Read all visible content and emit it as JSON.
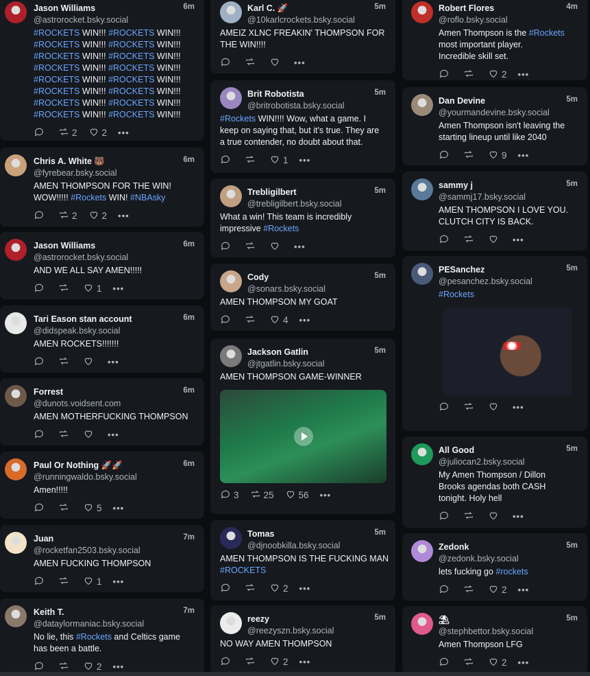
{
  "columns": {
    "a": [
      {
        "name": "Jason Williams",
        "handle": "@astrorocket.bsky.social",
        "time": "6m",
        "text": "#ROCKETS WIN!!! #ROCKETS WIN!!!\n#ROCKETS WIN!!! #ROCKETS WIN!!!\n#ROCKETS WIN!!! #ROCKETS WIN!!!\n#ROCKETS WIN!!! #ROCKETS WIN!!!\n#ROCKETS WIN!!! #ROCKETS WIN!!!\n#ROCKETS WIN!!! #ROCKETS WIN!!!\n#ROCKETS WIN!!! #ROCKETS WIN!!!\n#ROCKETS WIN!!! #ROCKETS WIN!!!",
        "replies": "",
        "reposts": "2",
        "likes": "2",
        "avatar_color": "#b0202a"
      },
      {
        "name": "Chris A. White 🐻",
        "handle": "@fyrebear.bsky.social",
        "time": "6m",
        "text": "AMEN THOMPSON FOR THE WIN!\nWOW!!!!! #Rockets WIN! #NBAsky",
        "replies": "",
        "reposts": "2",
        "likes": "2",
        "avatar_color": "#c9a27a"
      },
      {
        "name": "Jason Williams",
        "handle": "@astrorocket.bsky.social",
        "time": "6m",
        "text": "AND WE ALL SAY AMEN!!!!!",
        "replies": "",
        "reposts": "",
        "likes": "1",
        "avatar_color": "#b0202a"
      },
      {
        "name": "Tari Eason stan account",
        "handle": "@didspeak.bsky.social",
        "time": "6m",
        "text": "AMEN ROCKETS!!!!!!!",
        "replies": "",
        "reposts": "",
        "likes": "",
        "avatar_color": "#e8e8e8"
      },
      {
        "name": "Forrest",
        "handle": "@dunots.voidsent.com",
        "time": "6m",
        "text": "AMEN MOTHERFUCKING THOMPSON",
        "replies": "",
        "reposts": "",
        "likes": "",
        "avatar_color": "#6d5a4a"
      },
      {
        "name": "Paul Or Nothing 🚀🚀",
        "handle": "@runningwaldo.bsky.social",
        "time": "6m",
        "text": "Amen!!!!!",
        "replies": "",
        "reposts": "",
        "likes": "5",
        "avatar_color": "#d86a2a"
      },
      {
        "name": "Juan",
        "handle": "@rocketfan2503.bsky.social",
        "time": "7m",
        "text": "AMEN FUCKING THOMPSON",
        "replies": "",
        "reposts": "",
        "likes": "1",
        "avatar_color": "#f2e3c8"
      },
      {
        "name": "Keith T.",
        "handle": "@dataylormaniac.bsky.social",
        "time": "7m",
        "text": "No lie, this #Rockets and Celtics game\nhas been a battle.",
        "replies": "",
        "reposts": "",
        "likes": "2",
        "avatar_color": "#8a7a6a"
      }
    ],
    "b": [
      {
        "name": "Karl C. 🚀",
        "handle": "@10karlcrockets.bsky.social",
        "time": "5m",
        "text": "AMEIZ XLNC FREAKIN' THOMPSON FOR\nTHE WIN!!!!",
        "replies": "",
        "reposts": "",
        "likes": "",
        "avatar_color": "#9fb0c4"
      },
      {
        "name": "Brit Robotista",
        "handle": "@britrobotista.bsky.social",
        "time": "5m",
        "text": "#Rockets WIN!!!! Wow, what a game. I\nkeep on saying that, but it's true. They are\na true contender, no doubt about that.",
        "replies": "",
        "reposts": "",
        "likes": "1",
        "avatar_color": "#9a86c0"
      },
      {
        "name": "Trebligilbert",
        "handle": "@trebligilbert.bsky.social",
        "time": "5m",
        "text": "What a win! This team is incredibly\nimpressive #Rockets",
        "replies": "",
        "reposts": "",
        "likes": "",
        "avatar_color": "#c0a080"
      },
      {
        "name": "Cody",
        "handle": "@sonars.bsky.social",
        "time": "5m",
        "text": "AMEN THOMPSON MY GOAT",
        "replies": "",
        "reposts": "",
        "likes": "4",
        "avatar_color": "#c8a68a"
      },
      {
        "name": "Jackson Gatlin",
        "handle": "@jtgatlin.bsky.social",
        "time": "5m",
        "text": "AMEN THOMPSON GAME-WINNER",
        "replies": "3",
        "reposts": "25",
        "likes": "56",
        "avatar_color": "#7a7a7a",
        "has_video": true
      },
      {
        "name": "Tomas",
        "handle": "@djnoobkilla.bsky.social",
        "time": "5m",
        "text": "AMEN THOMPSON IS THE FUCKING MAN\n#ROCKETS",
        "replies": "",
        "reposts": "",
        "likes": "2",
        "avatar_color": "#2a2a5a"
      },
      {
        "name": "reezy",
        "handle": "@reezyszn.bsky.social",
        "time": "5m",
        "text": "NO WAY AMEN THOMPSON",
        "replies": "",
        "reposts": "",
        "likes": "2",
        "avatar_color": "#ececec"
      }
    ],
    "c": [
      {
        "name": "Robert Flores",
        "handle": "@roflo.bsky.social",
        "time": "4m",
        "text": "Amen Thompson is the #Rockets\nmost important player.\nIncredible skill set.",
        "replies": "",
        "reposts": "",
        "likes": "2",
        "avatar_color": "#c0302a"
      },
      {
        "name": "Dan Devine",
        "handle": "@yourmandevine.bsky.social",
        "time": "5m",
        "text": "Amen Thompson isn't leaving the\nstarting lineup until like 2040",
        "replies": "",
        "reposts": "",
        "likes": "9",
        "avatar_color": "#9c8a78"
      },
      {
        "name": "sammy j",
        "handle": "@sammj17.bsky.social",
        "time": "5m",
        "text": "AMEN THOMPSON I LOVE YOU.\nCLUTCH CITY IS BACK.",
        "replies": "",
        "reposts": "",
        "likes": "",
        "avatar_color": "#5a7a9a"
      },
      {
        "name": "PESanchez",
        "handle": "@pesanchez.bsky.social",
        "time": "5m",
        "text": "#Rockets",
        "replies": "",
        "reposts": "",
        "likes": "",
        "avatar_color": "#4a5a7a",
        "has_image": true
      },
      {
        "name": "All Good",
        "handle": "@juliocan2.bsky.social",
        "time": "5m",
        "text": "My Amen Thompson / Dillon\nBrooks agendas both CASH\ntonight. Holy hell",
        "replies": "",
        "reposts": "",
        "likes": "",
        "avatar_color": "#1e9a5a"
      },
      {
        "name": "Zedonk",
        "handle": "@zedonk.bsky.social",
        "time": "5m",
        "text": "lets fucking go #rockets",
        "replies": "",
        "reposts": "",
        "likes": "2",
        "avatar_color": "#b08ad8"
      },
      {
        "name": "⛱",
        "handle": "@stephbettor.bsky.social",
        "time": "5m",
        "text": "Amen Thompson LFG",
        "replies": "",
        "reposts": "",
        "likes": "2",
        "avatar_color": "#e05a8a"
      }
    ]
  }
}
